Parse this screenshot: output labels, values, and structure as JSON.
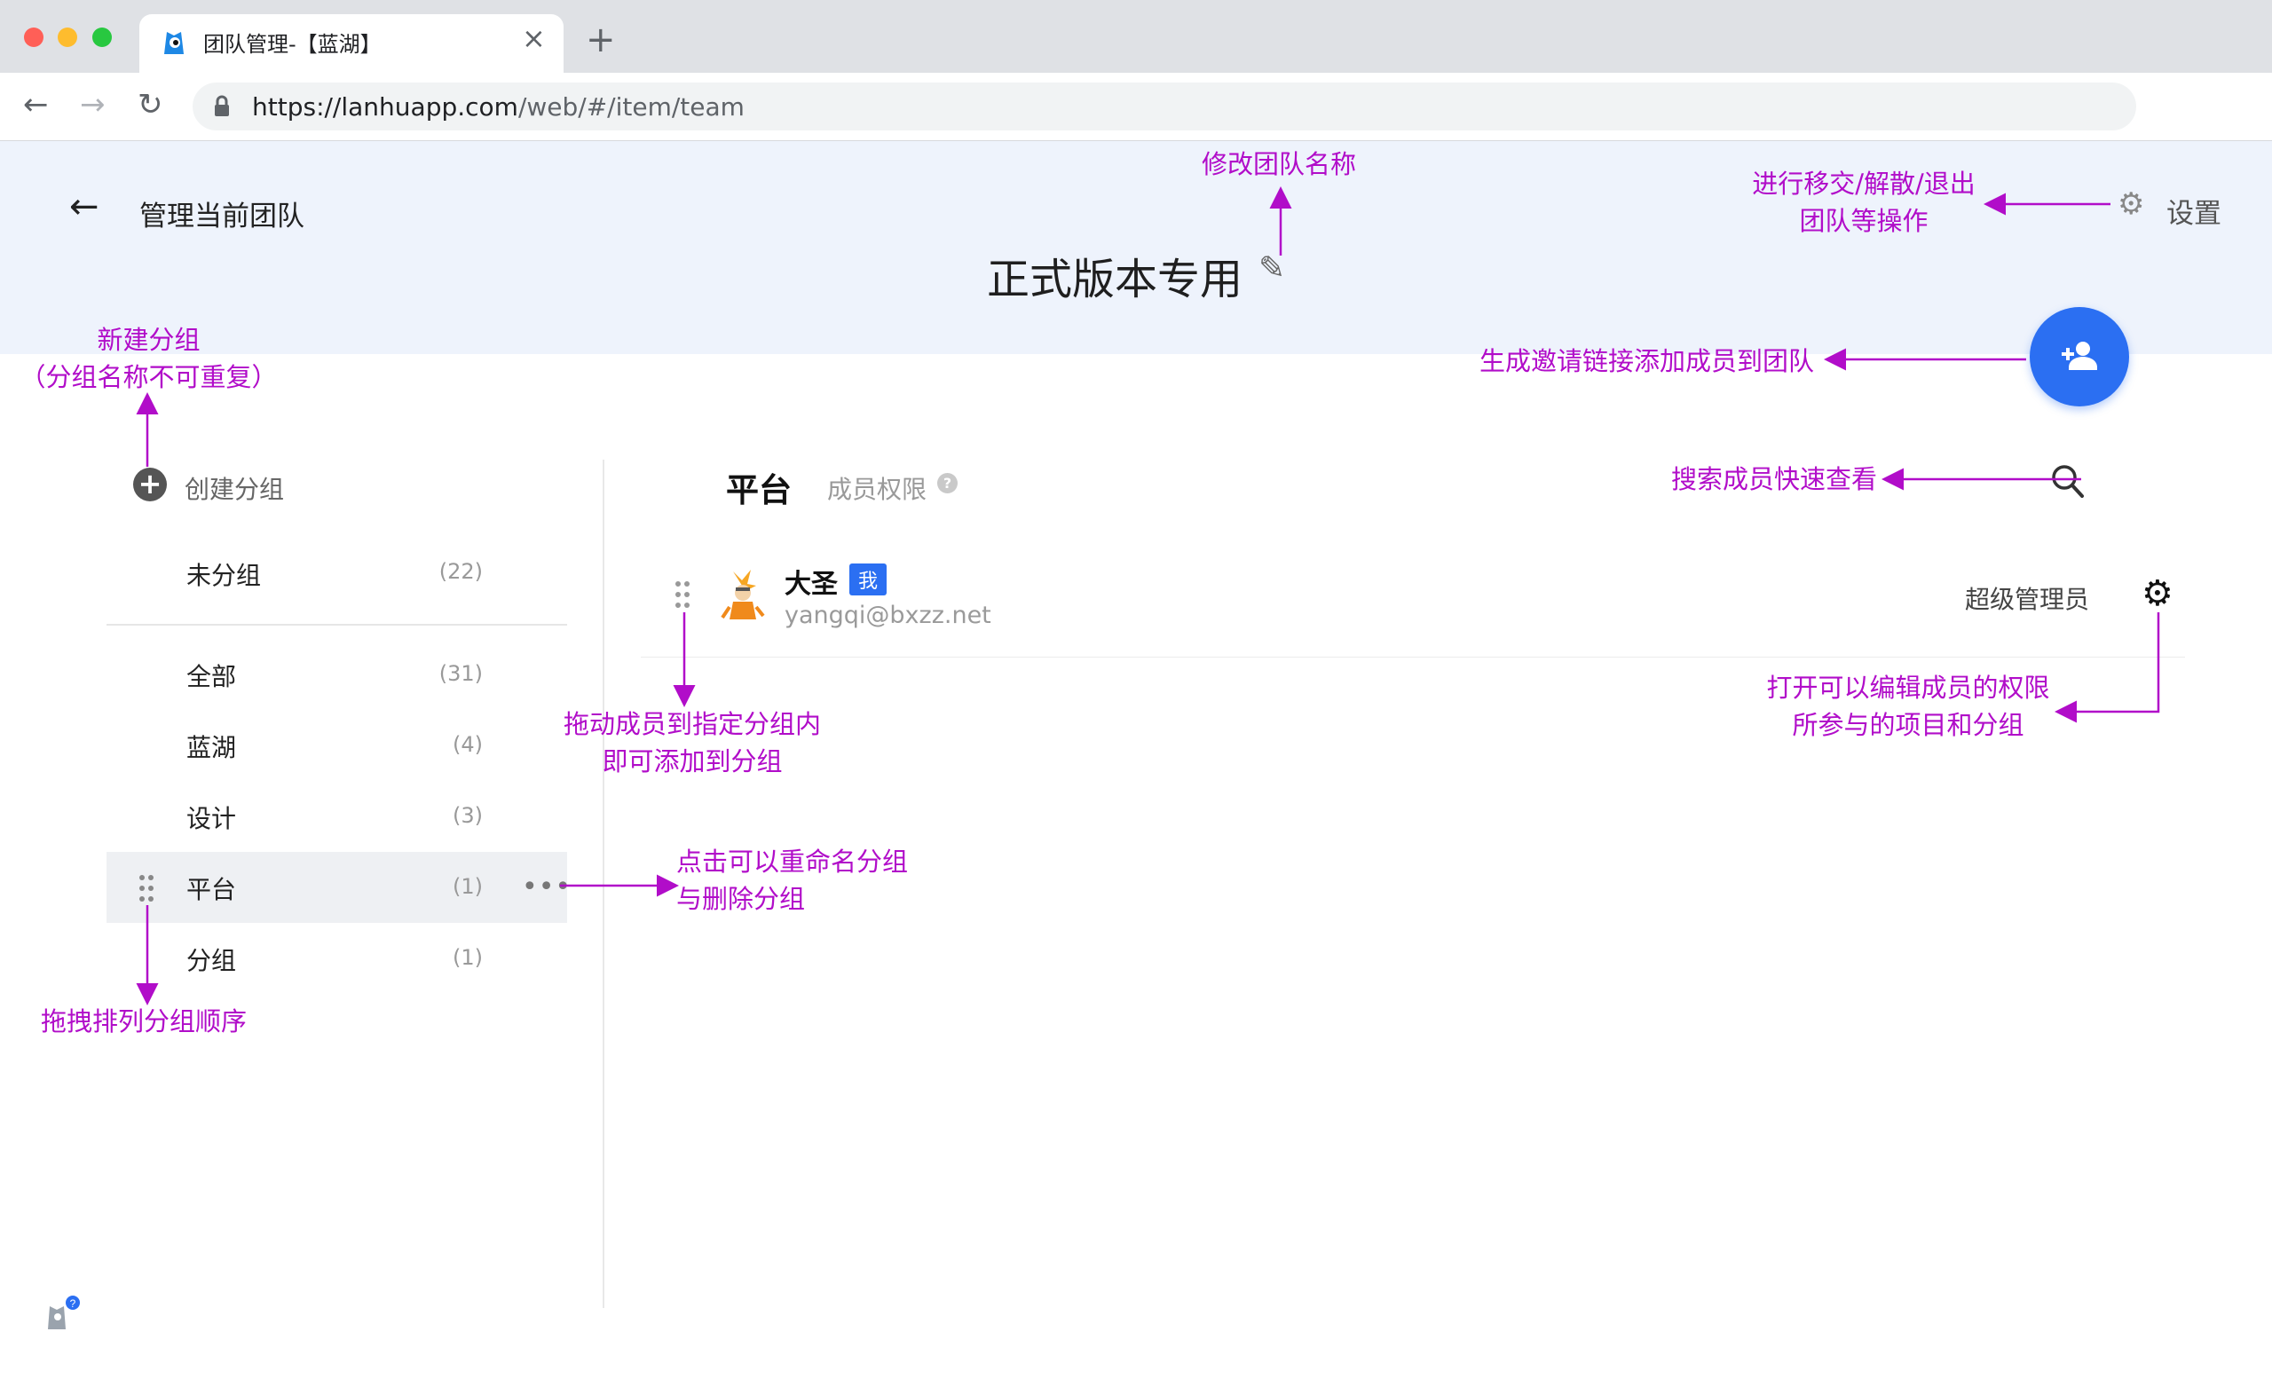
{
  "browser": {
    "tab_title": "团队管理-【蓝湖】",
    "close_icon": "×",
    "new_tab_icon": "+",
    "url_host": "https://lanhuapp.com",
    "url_path": "/web/#/item/team",
    "back_icon": "←",
    "forward_icon": "→",
    "reload_icon": "↻",
    "traffic_colors": [
      "#ff5f57",
      "#febc2e",
      "#28c840"
    ]
  },
  "header": {
    "back_icon": "←",
    "page_title": "管理当前团队",
    "team_name": "正式版本专用",
    "edit_icon": "✎",
    "settings_icon": "⚙",
    "settings_label": "设置",
    "invite_icon": "add-person-icon",
    "accent": "#2b6ff2"
  },
  "sidebar": {
    "create_icon": "+",
    "create_label": "创建分组",
    "ungrouped": {
      "label": "未分组",
      "count": "(22)"
    },
    "groups": [
      {
        "label": "全部",
        "count": "(31)"
      },
      {
        "label": "蓝湖",
        "count": "(4)"
      },
      {
        "label": "设计",
        "count": "(3)"
      },
      {
        "label": "平台",
        "count": "(1)"
      },
      {
        "label": "分组",
        "count": "(1)"
      }
    ],
    "active_index": 3,
    "more_icon": "•••"
  },
  "main": {
    "group_title": "平台",
    "perm_label": "成员权限",
    "perm_help_icon": "?",
    "members": [
      {
        "name": "大圣",
        "badge": "我",
        "email": "yangqi@bxzz.net",
        "role": "超级管理员"
      }
    ],
    "member_settings_icon": "⚙"
  },
  "annotations": {
    "rename_team": "修改团队名称",
    "settings_ops_1": "进行移交/解散/退出",
    "settings_ops_2": "团队等操作",
    "invite": "生成邀请链接添加成员到团队",
    "new_group_1": "新建分组",
    "new_group_2": "（分组名称不可重复）",
    "search": "搜索成员快速查看",
    "drag_member_1": "拖动成员到指定分组内",
    "drag_member_2": "即可添加到分组",
    "member_perm_1": "打开可以编辑成员的权限",
    "member_perm_2": "所参与的项目和分组",
    "rename_group_1": "点击可以重命名分组",
    "rename_group_2": "与删除分组",
    "sort_groups": "拖拽排列分组顺序",
    "color": "#b10dc9"
  }
}
